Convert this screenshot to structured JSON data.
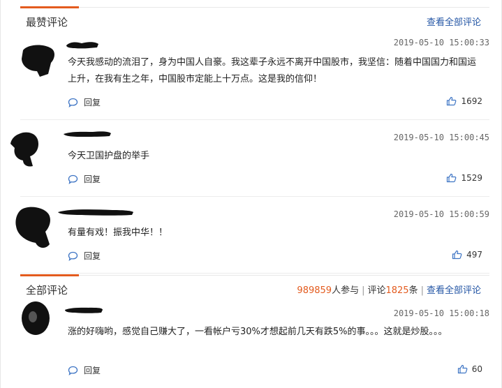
{
  "top_section": {
    "title": "最赞评论",
    "view_all": "查看全部评论"
  },
  "top_comments": [
    {
      "time": "2019-05-10 15:00:33",
      "content": "今天我感动的流泪了，身为中国人自豪。我这辈子永远不离开中国股市，我坚信：随着中国国力和国运上升，在我有生之年，中国股市定能上十万点。这是我的信仰！",
      "reply": "回复",
      "likes": "1692"
    },
    {
      "time": "2019-05-10 15:00:45",
      "content": "今天卫国护盘的举手",
      "reply": "回复",
      "likes": "1529"
    },
    {
      "time": "2019-05-10 15:00:59",
      "content": "有量有戏！振我中华！！",
      "reply": "回复",
      "likes": "497"
    }
  ],
  "all_section": {
    "title": "全部评论",
    "participants": "989859",
    "participants_suffix": "人参与",
    "comments_prefix": "评论",
    "comment_count": "1825",
    "comments_suffix": "条",
    "view_all": "查看全部评论"
  },
  "all_comments": [
    {
      "time": "2019-05-10 15:00:18",
      "content": "涨的好嗨哟，感觉自己赚大了，一看帐户亏30%才想起前几天有跌5%的事。。。这就是炒股。。。",
      "reply": "回复",
      "likes": "60"
    }
  ],
  "colors": {
    "accent": "#e35b1e",
    "link": "#2456a5",
    "reply_icon": "#3d74c4"
  }
}
